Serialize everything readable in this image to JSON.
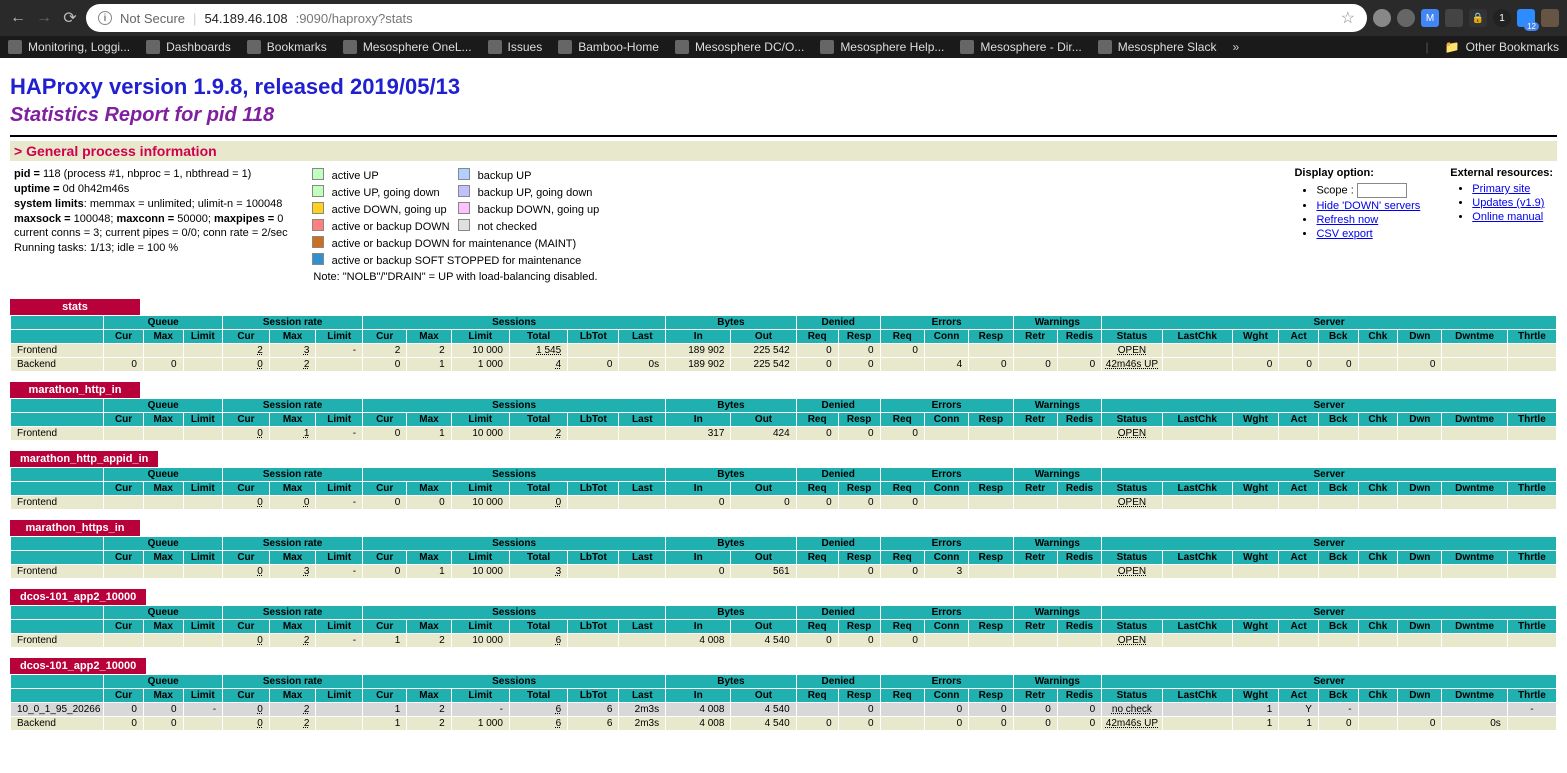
{
  "browser": {
    "url_secure": "Not Secure",
    "url_host": "54.189.46.108",
    "url_port_path": ":9090/haproxy?stats",
    "ext_badge": "12"
  },
  "bookmarks": [
    "Monitoring, Loggi...",
    "Dashboards",
    "Bookmarks",
    "Mesosphere OneL...",
    "Issues",
    "Bamboo-Home",
    "Mesosphere DC/O...",
    "Mesosphere Help...",
    "Mesosphere - Dir...",
    "Mesosphere Slack"
  ],
  "bookmarks_other": "Other Bookmarks",
  "page": {
    "title": "HAProxy version 1.9.8, released 2019/05/13",
    "subtitle": "Statistics Report for pid 118",
    "section": "> General process information"
  },
  "info": {
    "pid_label": "pid = ",
    "pid_val": "118 (process #1, nbproc = 1, nbthread = 1)",
    "uptime_label": "uptime = ",
    "uptime_val": "0d 0h42m46s",
    "syslim_label": "system limits",
    "syslim_val": ": memmax = unlimited; ulimit-n = 100048",
    "maxsock_label": "maxsock = ",
    "maxsock_val": "100048; ",
    "maxconn_label": "maxconn = ",
    "maxconn_val": "50000; ",
    "maxpipes_label": "maxpipes = ",
    "maxpipes_val": "0",
    "curr": "current conns = 3; current pipes = 0/0; conn rate = 2/sec",
    "tasks": "Running tasks: 1/13; idle = 100 %"
  },
  "legend": {
    "r0c0": "active UP",
    "r0c1": "backup UP",
    "r1c0": "active UP, going down",
    "r1c1": "backup UP, going down",
    "r2c0": "active DOWN, going up",
    "r2c1": "backup DOWN, going up",
    "r3c0": "active or backup DOWN",
    "r3c1": "not checked",
    "r4": "active or backup DOWN for maintenance (MAINT)",
    "r5": "active or backup SOFT STOPPED for maintenance",
    "note": "Note: \"NOLB\"/\"DRAIN\" = UP with load-balancing disabled."
  },
  "legend_colors": {
    "active_up": "#c0ffc0",
    "backup_up": "#b0d0ff",
    "active_up_going_down": "#c0ffc0",
    "backup_up_going_down": "#c0c0ff",
    "active_down_going_up": "#ffd020",
    "backup_down_going_up": "#ffc0ff",
    "down": "#ff8080",
    "not_checked": "#e0e0e0",
    "maint": "#cc7020",
    "soft": "#3090d0"
  },
  "display_option": {
    "title": "Display option:",
    "scope": "Scope :",
    "hide": "Hide 'DOWN' servers",
    "refresh": "Refresh now",
    "csv": "CSV export"
  },
  "external": {
    "title": "External resources:",
    "primary": "Primary site",
    "updates": "Updates (v1.9)",
    "manual": "Online manual"
  },
  "hdr_groups": [
    "",
    "Queue",
    "Session rate",
    "Sessions",
    "Bytes",
    "Denied",
    "Errors",
    "Warnings",
    "Server"
  ],
  "hdr_cols": [
    "",
    "Cur",
    "Max",
    "Limit",
    "Cur",
    "Max",
    "Limit",
    "Cur",
    "Max",
    "Limit",
    "Total",
    "LbTot",
    "Last",
    "In",
    "Out",
    "Req",
    "Resp",
    "Req",
    "Conn",
    "Resp",
    "Retr",
    "Redis",
    "Status",
    "LastChk",
    "Wght",
    "Act",
    "Bck",
    "Chk",
    "Dwn",
    "Dwntme",
    "Thrtle"
  ],
  "proxies": [
    {
      "name": "stats",
      "rows": [
        {
          "type": "frontend",
          "name": "Frontend",
          "cells": [
            "",
            "",
            "",
            "2",
            "3",
            "-",
            "2",
            "2",
            "10 000",
            "1 545",
            "",
            "",
            "189 902",
            "225 542",
            "0",
            "0",
            "0",
            "",
            "",
            "",
            "",
            "OPEN",
            "",
            "",
            "",
            "",
            "",
            "",
            "",
            ""
          ]
        },
        {
          "type": "backend",
          "name": "Backend",
          "cells": [
            "0",
            "0",
            "",
            "0",
            "2",
            "",
            "0",
            "1",
            "1 000",
            "4",
            "0",
            "0s",
            "189 902",
            "225 542",
            "0",
            "0",
            "",
            "4",
            "0",
            "0",
            "0",
            "42m46s UP",
            "",
            "0",
            "0",
            "0",
            "",
            "0",
            "",
            ""
          ]
        }
      ]
    },
    {
      "name": "marathon_http_in",
      "rows": [
        {
          "type": "frontend",
          "name": "Frontend",
          "cells": [
            "",
            "",
            "",
            "0",
            "1",
            "-",
            "0",
            "1",
            "10 000",
            "2",
            "",
            "",
            "317",
            "424",
            "0",
            "0",
            "0",
            "",
            "",
            "",
            "",
            "OPEN",
            "",
            "",
            "",
            "",
            "",
            "",
            "",
            ""
          ]
        }
      ]
    },
    {
      "name": "marathon_http_appid_in",
      "rows": [
        {
          "type": "frontend",
          "name": "Frontend",
          "cells": [
            "",
            "",
            "",
            "0",
            "0",
            "-",
            "0",
            "0",
            "10 000",
            "0",
            "",
            "",
            "0",
            "0",
            "0",
            "0",
            "0",
            "",
            "",
            "",
            "",
            "OPEN",
            "",
            "",
            "",
            "",
            "",
            "",
            "",
            ""
          ]
        }
      ]
    },
    {
      "name": "marathon_https_in",
      "rows": [
        {
          "type": "frontend",
          "name": "Frontend",
          "cells": [
            "",
            "",
            "",
            "0",
            "3",
            "-",
            "0",
            "1",
            "10 000",
            "3",
            "",
            "",
            "0",
            "561",
            "",
            "0",
            "0",
            "3",
            "",
            "",
            "",
            "OPEN",
            "",
            "",
            "",
            "",
            "",
            "",
            "",
            ""
          ]
        }
      ]
    },
    {
      "name": "dcos-101_app2_10000",
      "rows": [
        {
          "type": "frontend",
          "name": "Frontend",
          "cells": [
            "",
            "",
            "",
            "0",
            "2",
            "-",
            "1",
            "2",
            "10 000",
            "6",
            "",
            "",
            "4 008",
            "4 540",
            "0",
            "0",
            "0",
            "",
            "",
            "",
            "",
            "OPEN",
            "",
            "",
            "",
            "",
            "",
            "",
            "",
            ""
          ]
        }
      ]
    },
    {
      "name": "dcos-101_app2_10000",
      "rows": [
        {
          "type": "server",
          "name": "10_0_1_95_20266",
          "cells": [
            "0",
            "0",
            "-",
            "0",
            "2",
            "",
            "1",
            "2",
            "-",
            "6",
            "6",
            "2m3s",
            "4 008",
            "4 540",
            "",
            "0",
            "",
            "0",
            "0",
            "0",
            "0",
            "no check",
            "",
            "1",
            "Y",
            "-",
            "",
            "",
            "",
            "-"
          ]
        },
        {
          "type": "backend",
          "name": "Backend",
          "cells": [
            "0",
            "0",
            "",
            "0",
            "2",
            "",
            "1",
            "2",
            "1 000",
            "6",
            "6",
            "2m3s",
            "4 008",
            "4 540",
            "0",
            "0",
            "",
            "0",
            "0",
            "0",
            "0",
            "42m46s UP",
            "",
            "1",
            "1",
            "0",
            "",
            "0",
            "0s",
            ""
          ]
        }
      ]
    }
  ]
}
